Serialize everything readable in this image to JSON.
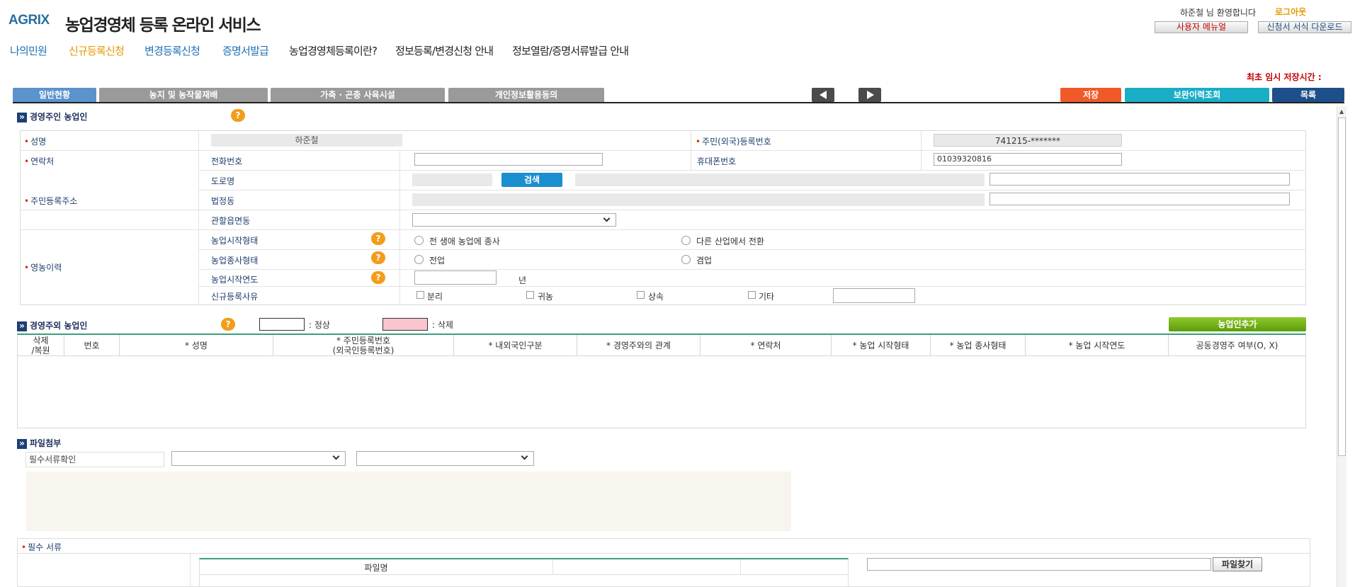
{
  "header": {
    "logo_text": "AGRIX",
    "site_title": "농업경영체 등록 온라인 서비스",
    "welcome": "하준철 님 환영합니다",
    "logout": "로그아웃",
    "user_menual": "사용자 메뉴얼",
    "form_download": "신청서 서식 다운로드"
  },
  "nav": [
    "나의민원",
    "신규등록신청",
    "변경등록신청",
    "증명서발급",
    "농업경영체등록이란?",
    "정보등록/변경신청 안내",
    "정보열람/증명서류발급 안내"
  ],
  "save_time_label": "최초 임시 저장시간 :",
  "tabs": [
    "일반현황",
    "농지 및 농작물재배",
    "가축 · 곤충 사육시설",
    "개인정보활용동의"
  ],
  "actions": {
    "save": "저장",
    "history": "보완이력조회",
    "list": "목록"
  },
  "owner_section": {
    "title": "경영주인 농업인",
    "name_label": "성명",
    "name_value": "하준철",
    "rrn_label": "주민(외국)등록번호",
    "rrn_value": "741215-*******",
    "contact_label": "연락처",
    "phone_label": "전화번호",
    "phone_value": "",
    "mobile_label": "휴대폰번호",
    "mobile_value": "01039320816",
    "address_label": "주민등록주소",
    "road_label": "도로명",
    "search_button": "검색",
    "legal_dong_label": "법정동",
    "admin_dong_label": "관할읍면동",
    "career_label": "영농이력",
    "start_type_label": "농업시작형태",
    "start_type_options": [
      "전 생애 농업에 종사",
      "다른 산업에서 전환"
    ],
    "work_type_label": "농업종사형태",
    "work_type_options": [
      "전업",
      "겸업"
    ],
    "start_year_label": "농업시작연도",
    "year_unit": "년",
    "reason_label": "신규등록사유",
    "reason_options": [
      "분리",
      "귀농",
      "상속",
      "기타"
    ]
  },
  "others_section": {
    "title": "경영주외 농업인",
    "legend_normal": ": 정상",
    "legend_delete": ": 삭제",
    "add_button": "농업인추가",
    "columns": [
      "삭제\n/복원",
      "번호",
      "* 성명",
      "* 주민등록번호\n(외국인등록번호)",
      "* 내외국인구분",
      "* 경영주와의 관계",
      "* 연락처",
      "* 농업 시작형태",
      "* 농업 종사형태",
      "* 농업 시작연도",
      "공동경영주 여부(O, X)"
    ]
  },
  "file_section": {
    "title": "파일첨부",
    "doc_check_label": "필수서류확인",
    "required_docs_title": "필수 서류",
    "file_name_col": "파일명",
    "find_button": "파일찾기"
  },
  "colors": {
    "accent": "#1d3f74",
    "orange": "#e49a00",
    "save": "#f05a28",
    "history": "#1aaec6",
    "list": "#1d4f8a",
    "green": "#6aab14"
  }
}
